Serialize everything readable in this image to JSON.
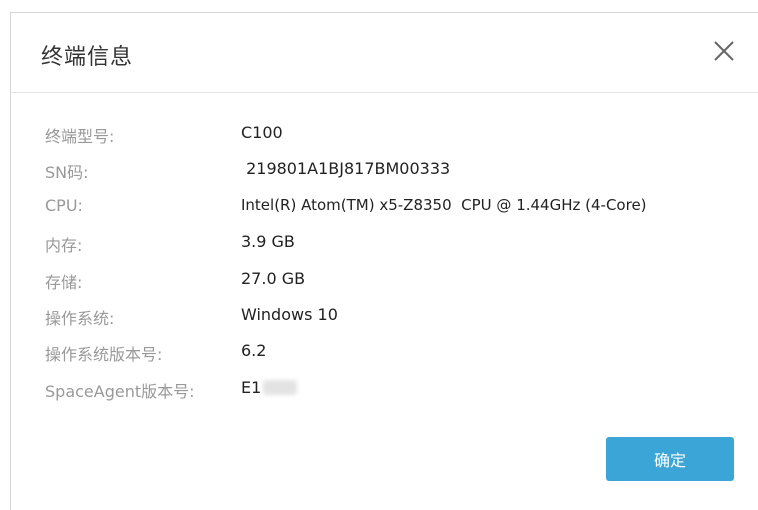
{
  "dialog": {
    "title": "终端信息",
    "confirm_label": "确定",
    "rows": [
      {
        "label": "终端型号:",
        "value": "C100"
      },
      {
        "label": "SN码:",
        "value": " 219801A1BJ817BM00333"
      },
      {
        "label": "CPU:",
        "value": "Intel(R) Atom(TM) x5-Z8350  CPU @ 1.44GHz (4-Core)"
      },
      {
        "label": "内存:",
        "value": "3.9 GB"
      },
      {
        "label": "存储:",
        "value": "27.0 GB"
      },
      {
        "label": "操作系统:",
        "value": "Windows 10"
      },
      {
        "label": "操作系统版本号:",
        "value": "6.2"
      },
      {
        "label": "SpaceAgent版本号:",
        "value": "E1"
      }
    ]
  },
  "icons": {
    "close": "close-icon"
  }
}
